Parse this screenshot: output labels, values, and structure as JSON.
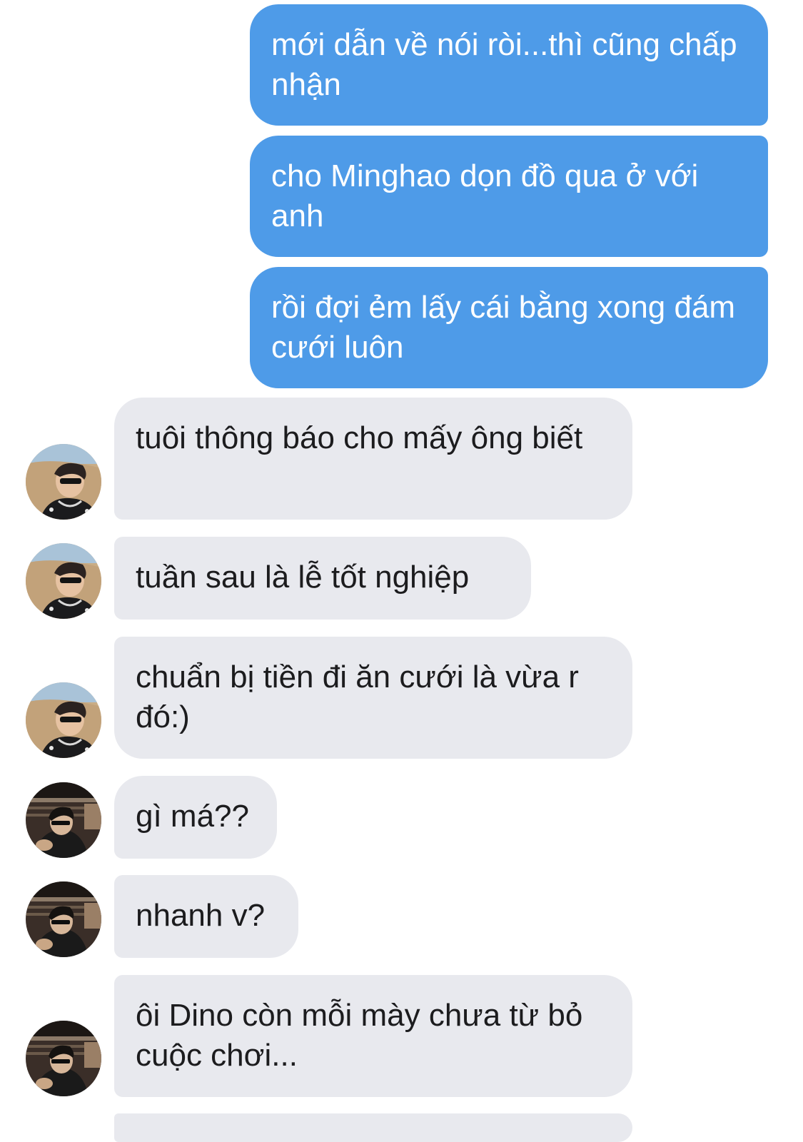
{
  "messages": [
    {
      "id": "m1",
      "direction": "outgoing",
      "text": "mới dẫn về nói ròi...thì cũng chấp nhận"
    },
    {
      "id": "m2",
      "direction": "outgoing",
      "text": "cho Minghao dọn đồ qua ở với anh"
    },
    {
      "id": "m3",
      "direction": "outgoing",
      "text": "rồi đợi ẻm lấy cái bằng xong đám cưới luôn"
    },
    {
      "id": "m4",
      "direction": "incoming",
      "sender_avatar": "avatar-a",
      "text": "tuôi thông báo cho mấy ông biết"
    },
    {
      "id": "m5",
      "direction": "incoming",
      "sender_avatar": "avatar-a",
      "text": "tuần sau là lễ tốt nghiệp"
    },
    {
      "id": "m6",
      "direction": "incoming",
      "sender_avatar": "avatar-a",
      "text": "chuẩn bị tiền đi ăn cưới là vừa r đó:)"
    },
    {
      "id": "m7",
      "direction": "incoming",
      "sender_avatar": "avatar-b",
      "text": "gì má??"
    },
    {
      "id": "m8",
      "direction": "incoming",
      "sender_avatar": "avatar-b",
      "text": "nhanh v?"
    },
    {
      "id": "m9",
      "direction": "incoming",
      "sender_avatar": "avatar-b",
      "text": "ôi Dino còn mỗi mày chưa từ bỏ cuộc chơi..."
    }
  ],
  "colors": {
    "outgoing_bubble": "#4e9be8",
    "incoming_bubble": "#e8e9ee",
    "outgoing_text": "#ffffff",
    "incoming_text": "#1c1c1e",
    "background": "#ffffff"
  }
}
